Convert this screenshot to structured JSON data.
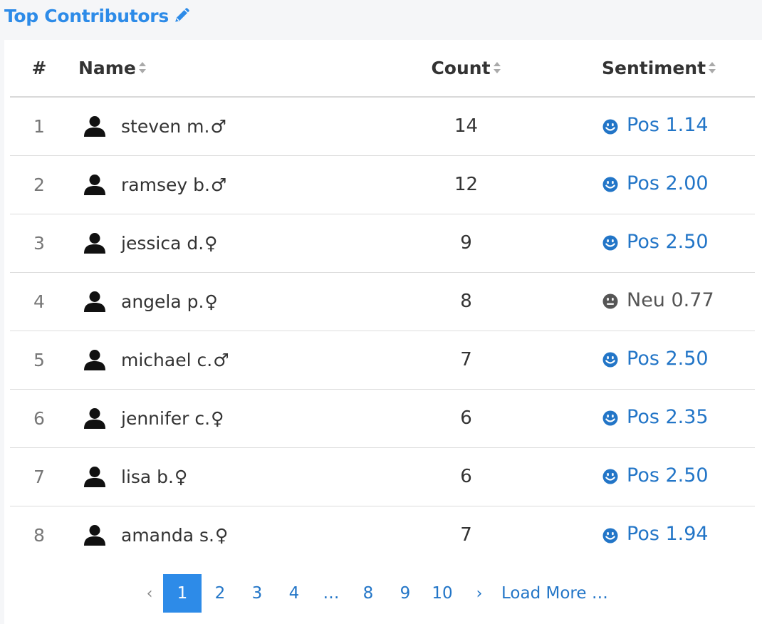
{
  "header": {
    "title": "Top Contributors"
  },
  "table": {
    "columns": {
      "num": "#",
      "name": "Name",
      "count": "Count",
      "sentiment": "Sentiment"
    },
    "rows": [
      {
        "num": "1",
        "name": "steven m.",
        "gender": "♂",
        "count": "14",
        "sentiment": "Pos 1.14",
        "sentiment_type": "positive"
      },
      {
        "num": "2",
        "name": "ramsey b.",
        "gender": "♂",
        "count": "12",
        "sentiment": "Pos 2.00",
        "sentiment_type": "positive"
      },
      {
        "num": "3",
        "name": "jessica d.",
        "gender": "♀",
        "count": "9",
        "sentiment": "Pos 2.50",
        "sentiment_type": "positive"
      },
      {
        "num": "4",
        "name": "angela p.",
        "gender": "♀",
        "count": "8",
        "sentiment": "Neu 0.77",
        "sentiment_type": "neutral"
      },
      {
        "num": "5",
        "name": "michael c.",
        "gender": "♂",
        "count": "7",
        "sentiment": "Pos 2.50",
        "sentiment_type": "positive"
      },
      {
        "num": "6",
        "name": "jennifer c.",
        "gender": "♀",
        "count": "6",
        "sentiment": "Pos 2.35",
        "sentiment_type": "positive"
      },
      {
        "num": "7",
        "name": "lisa b.",
        "gender": "♀",
        "count": "6",
        "sentiment": "Pos 2.50",
        "sentiment_type": "positive"
      },
      {
        "num": "8",
        "name": "amanda s.",
        "gender": "♀",
        "count": "7",
        "sentiment": "Pos 1.94",
        "sentiment_type": "positive"
      }
    ]
  },
  "pagination": {
    "prev": "‹",
    "pages": [
      "1",
      "2",
      "3",
      "4",
      "…",
      "8",
      "9",
      "10"
    ],
    "current": "1",
    "next": "›",
    "load_more": "Load More …"
  },
  "colors": {
    "accent": "#2d8be8",
    "link": "#2275c7",
    "neutral": "#555555"
  },
  "icons": {
    "edit": "pencil-icon",
    "sort": "sort-icon",
    "user": "person-icon",
    "positive": "smile-icon",
    "neutral": "meh-icon"
  }
}
